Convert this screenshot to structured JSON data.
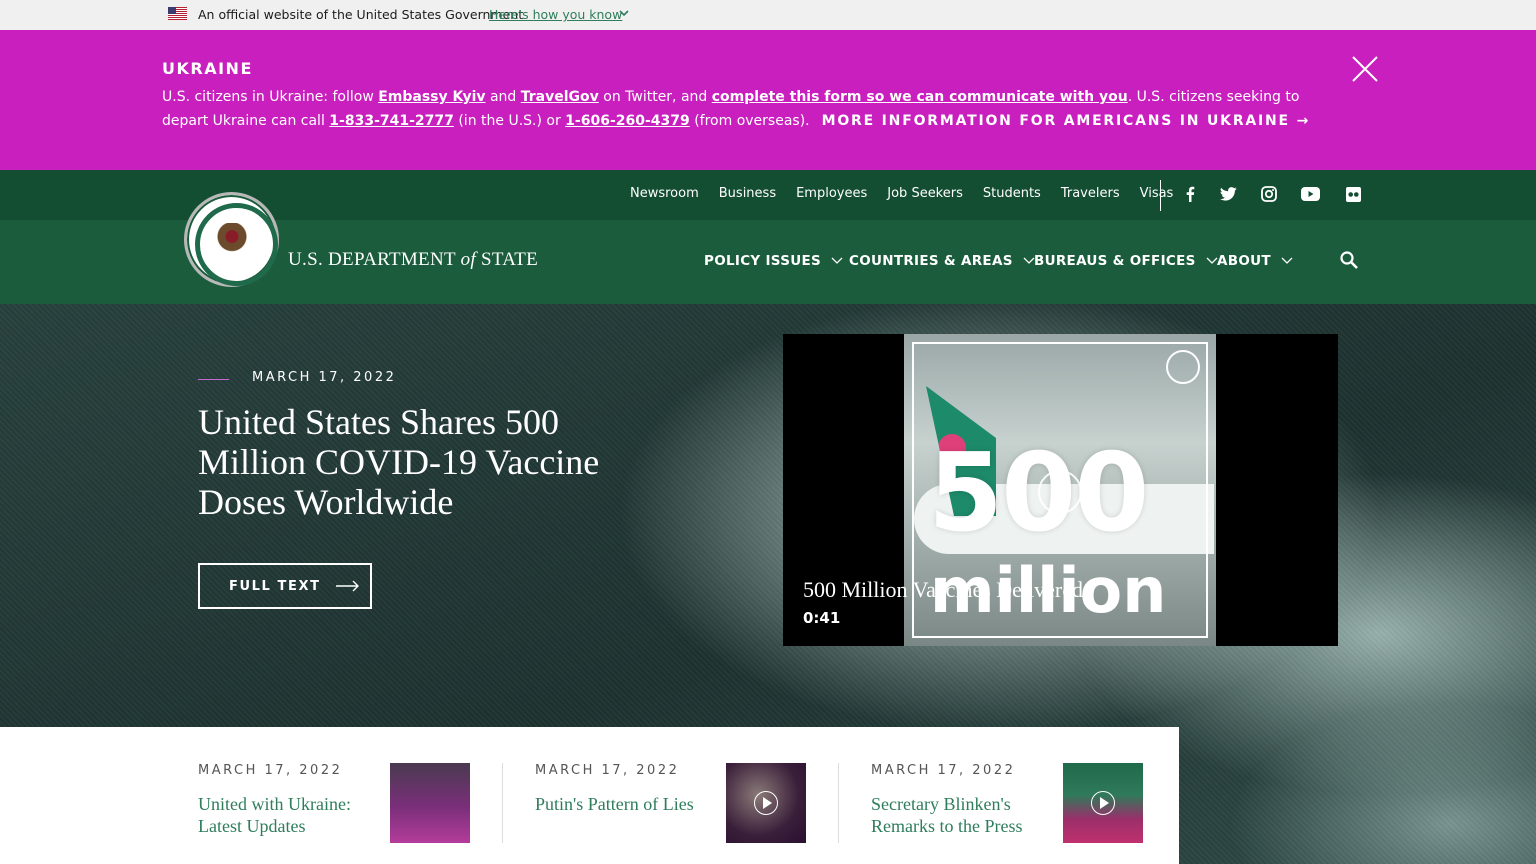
{
  "gov_banner": {
    "text": "An official website of the United States Government",
    "link": "Here's how you know"
  },
  "alert": {
    "title": "UKRAINE",
    "p1": "U.S. citizens in Ukraine: follow ",
    "link1": "Embassy Kyiv",
    "p2": " and ",
    "link2": "TravelGov",
    "p3": " on Twitter, and ",
    "link3": "complete this form so we can communicate with you",
    "p4": ". U.S. citizens seeking to depart Ukraine can call ",
    "phone1": "1-833-741-2777",
    "p5": " (in the U.S.) or ",
    "phone2": "1-606-260-4379",
    "p6": " (from overseas).",
    "more": "MORE INFORMATION FOR AMERICANS IN UKRAINE →"
  },
  "utility_links": [
    "Newsroom",
    "Business",
    "Employees",
    "Job Seekers",
    "Students",
    "Travelers",
    "Visas"
  ],
  "social": [
    "facebook-icon",
    "twitter-icon",
    "instagram-icon",
    "youtube-icon",
    "flickr-icon"
  ],
  "brand": {
    "pre": "U.S. DEPARTMENT ",
    "of": "of",
    "post": " STATE"
  },
  "nav": [
    "POLICY ISSUES",
    "COUNTRIES & AREAS",
    "BUREAUS & OFFICES",
    "ABOUT"
  ],
  "hero": {
    "date": "MARCH 17, 2022",
    "title": "United States Shares 500 Million COVID-19 Vaccine Doses Worldwide",
    "button": "FULL TEXT",
    "video": {
      "big_number": "500",
      "big_word": "million",
      "title": "500 Million Vaccines Delivered",
      "duration": "0:41"
    }
  },
  "cards": [
    {
      "date": "MARCH 17, 2022",
      "title": "United with Ukraine: Latest Updates"
    },
    {
      "date": "MARCH 17, 2022",
      "title": "Putin's Pattern of Lies"
    },
    {
      "date": "MARCH 17, 2022",
      "title": "Secretary Blinken's Remarks to the Press"
    }
  ],
  "colors": {
    "alert_bg": "#c91fbe",
    "header_green": "#1a5c3c",
    "link_green": "#2e7d5b"
  }
}
